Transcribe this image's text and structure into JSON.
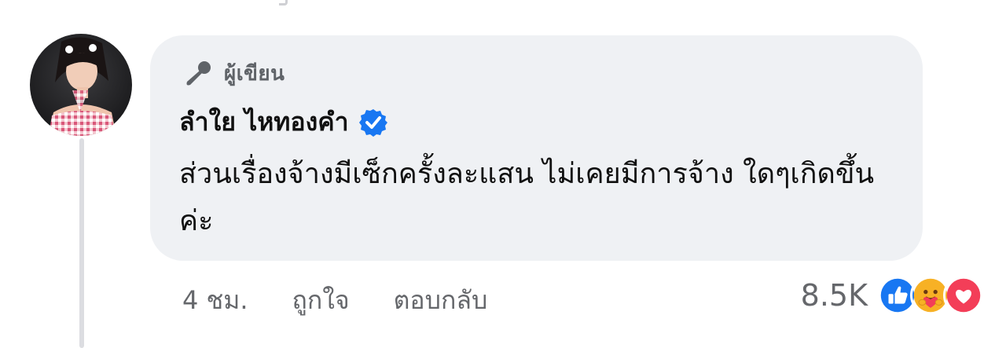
{
  "comment": {
    "badge_label": "ผู้เขียน",
    "author_name": "ลำใย ไหทองคำ",
    "text": "ส่วนเรื่องจ้างมีเซ็กครั้งละแสน ไม่เคยมีการจ้าง ใดๆเกิดขึ้นค่ะ",
    "verified": true
  },
  "actions": {
    "timestamp": "4 ชม.",
    "like_label": "ถูกใจ",
    "reply_label": "ตอบกลับ"
  },
  "reactions": {
    "count": "8.5K",
    "icons": [
      "like-icon",
      "care-icon",
      "love-icon"
    ]
  },
  "icons": {
    "badge": "microphone-icon",
    "verified": "verified-check-icon"
  },
  "colors": {
    "bubble": "#eff1f4",
    "like": "#1877f2",
    "love": "#f33e58",
    "care": "#f7b125",
    "verified": "#1877f2"
  }
}
